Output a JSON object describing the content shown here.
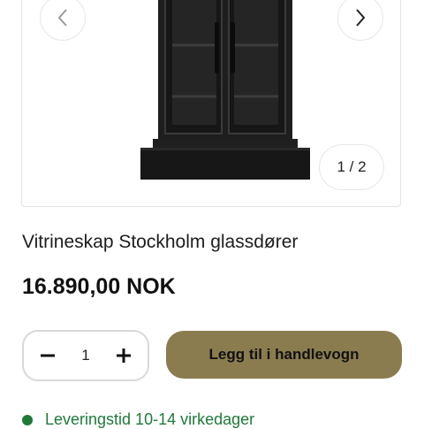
{
  "gallery": {
    "counter": "1 / 2",
    "prev_icon": "chevron-left-icon",
    "next_icon": "chevron-right-icon"
  },
  "product": {
    "title": "Vitrineskap Stockholm glassdører",
    "price": "16.890,00 NOK"
  },
  "quantity": {
    "value": "1",
    "minus_icon": "minus-icon",
    "plus_icon": "plus-icon"
  },
  "cart": {
    "add_label": "Legg til i handlevogn",
    "button_color": "#8a7c4e"
  },
  "delivery": {
    "text": "Leveringstid 10-14 virkedager",
    "status_color": "#1f7a3a"
  }
}
